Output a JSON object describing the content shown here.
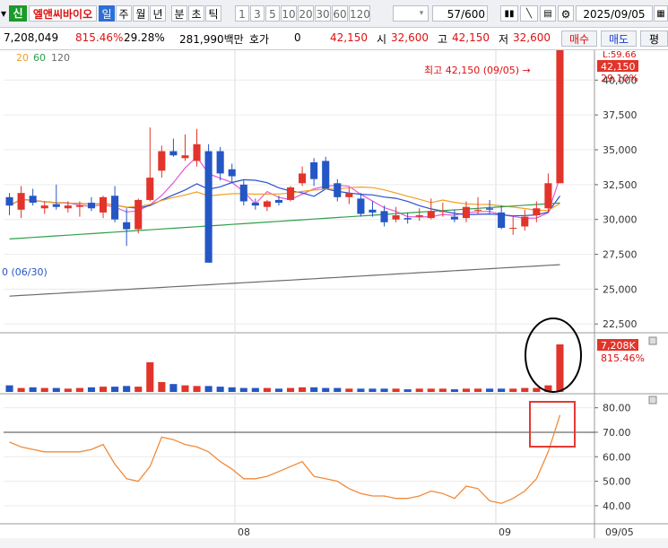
{
  "toolbar": {
    "market_badge": "신",
    "stock_name": "엘앤씨바이오",
    "periods": [
      "일",
      "주",
      "월",
      "년",
      "분",
      "초",
      "틱"
    ],
    "intervals": [
      "1",
      "3",
      "5",
      "10",
      "20",
      "30",
      "60",
      "120"
    ],
    "count": "57",
    "count_total": "/600",
    "date": "2025/09/05"
  },
  "quote": {
    "volume": "7,208,049",
    "volume_ratio": "815.46%",
    "turnover": "29.28%",
    "amount": "281,990백만",
    "hoga_label": "호가",
    "hoga_value": "0",
    "price": "42,150",
    "open_label": "시",
    "open": "32,600",
    "high_label": "고",
    "high": "42,150",
    "low_label": "저",
    "low": "32,600",
    "buy_label": "매수",
    "sell_label": "매도",
    "eval_label": "평"
  },
  "price_panel": {
    "ma_labels": [
      "20",
      "60",
      "120"
    ],
    "high_annotation": "최고 42,150 (09/05) →",
    "low_annotation": "0 (06/30)",
    "current_price_tag": "42,150",
    "current_change": "29.10%",
    "top_right_text": "L:59.66",
    "y_labels": [
      "40,000",
      "37,500",
      "35,000",
      "32,500",
      "30,000",
      "27,500",
      "25,000",
      "22,500"
    ]
  },
  "volume_panel": {
    "tag": "7,208K",
    "change": "815.46%"
  },
  "osc_panel": {
    "y_labels": [
      "80.00",
      "70.00",
      "60.00",
      "50.00",
      "40.00"
    ]
  },
  "x_axis": {
    "labels": [
      "08",
      "09"
    ],
    "current_label": "09/05"
  },
  "colors": {
    "up": "#e2342a",
    "down": "#2456c5",
    "ma5": "#e35bd6",
    "ma10": "#2b4fd0",
    "ma20": "#f0a020",
    "ma60": "#2ea04a",
    "ma120": "#6b6b6b",
    "osc": "#f08a3a",
    "highlight_box": "#e53935"
  },
  "chart_data": [
    {
      "type": "candlestick",
      "title": "",
      "ylim": [
        22500,
        41500
      ],
      "candles": [
        {
          "o": 31600,
          "h": 31900,
          "l": 30300,
          "c": 31000
        },
        {
          "o": 30700,
          "h": 32400,
          "l": 30100,
          "c": 31900
        },
        {
          "o": 31700,
          "h": 32200,
          "l": 31000,
          "c": 31200
        },
        {
          "o": 30800,
          "h": 31300,
          "l": 30400,
          "c": 31000
        },
        {
          "o": 31100,
          "h": 32500,
          "l": 30700,
          "c": 30900
        },
        {
          "o": 30800,
          "h": 31300,
          "l": 30500,
          "c": 31000
        },
        {
          "o": 30900,
          "h": 31300,
          "l": 30200,
          "c": 31000
        },
        {
          "o": 31200,
          "h": 31600,
          "l": 30600,
          "c": 30800
        },
        {
          "o": 30500,
          "h": 31700,
          "l": 30100,
          "c": 31600
        },
        {
          "o": 31700,
          "h": 32400,
          "l": 29800,
          "c": 30000
        },
        {
          "o": 29800,
          "h": 30800,
          "l": 28100,
          "c": 29300
        },
        {
          "o": 29300,
          "h": 31500,
          "l": 29000,
          "c": 31400
        },
        {
          "o": 31400,
          "h": 36600,
          "l": 31300,
          "c": 33000
        },
        {
          "o": 33500,
          "h": 35300,
          "l": 33000,
          "c": 34900
        },
        {
          "o": 34900,
          "h": 35800,
          "l": 34500,
          "c": 34600
        },
        {
          "o": 34400,
          "h": 36100,
          "l": 34200,
          "c": 34600
        },
        {
          "o": 34200,
          "h": 36500,
          "l": 33800,
          "c": 35400
        },
        {
          "o": 34900,
          "h": 35400,
          "l": 26900,
          "c": 26900
        },
        {
          "o": 34900,
          "h": 35200,
          "l": 32800,
          "c": 33300
        },
        {
          "o": 33600,
          "h": 34000,
          "l": 32600,
          "c": 33100
        },
        {
          "o": 32500,
          "h": 32800,
          "l": 31000,
          "c": 31300
        },
        {
          "o": 31200,
          "h": 31500,
          "l": 30700,
          "c": 31000
        },
        {
          "o": 30900,
          "h": 31400,
          "l": 30600,
          "c": 31300
        },
        {
          "o": 31400,
          "h": 31700,
          "l": 31000,
          "c": 31200
        },
        {
          "o": 31400,
          "h": 32400,
          "l": 31300,
          "c": 32300
        },
        {
          "o": 32600,
          "h": 33800,
          "l": 32400,
          "c": 33300
        },
        {
          "o": 34100,
          "h": 34400,
          "l": 32400,
          "c": 32900
        },
        {
          "o": 34200,
          "h": 34500,
          "l": 32400,
          "c": 32200
        },
        {
          "o": 32600,
          "h": 32900,
          "l": 31300,
          "c": 31600
        },
        {
          "o": 31600,
          "h": 32300,
          "l": 31100,
          "c": 31900
        },
        {
          "o": 31500,
          "h": 31900,
          "l": 30200,
          "c": 30400
        },
        {
          "o": 30700,
          "h": 31300,
          "l": 30200,
          "c": 30500
        },
        {
          "o": 30600,
          "h": 31000,
          "l": 29500,
          "c": 29800
        },
        {
          "o": 30000,
          "h": 30900,
          "l": 29800,
          "c": 30300
        },
        {
          "o": 30100,
          "h": 30500,
          "l": 29700,
          "c": 30000
        },
        {
          "o": 30200,
          "h": 30800,
          "l": 29900,
          "c": 30300
        },
        {
          "o": 30100,
          "h": 31500,
          "l": 30000,
          "c": 30600
        },
        {
          "o": 30600,
          "h": 31200,
          "l": 30200,
          "c": 30600
        },
        {
          "o": 30200,
          "h": 30700,
          "l": 29800,
          "c": 30000
        },
        {
          "o": 30100,
          "h": 31300,
          "l": 29800,
          "c": 30900
        },
        {
          "o": 30700,
          "h": 31600,
          "l": 30400,
          "c": 30700
        },
        {
          "o": 30800,
          "h": 31400,
          "l": 30400,
          "c": 30700
        },
        {
          "o": 30500,
          "h": 31000,
          "l": 29300,
          "c": 29400
        },
        {
          "o": 29400,
          "h": 30200,
          "l": 28900,
          "c": 29400
        },
        {
          "o": 29500,
          "h": 30700,
          "l": 29200,
          "c": 30200
        },
        {
          "o": 30300,
          "h": 31300,
          "l": 29800,
          "c": 30800
        },
        {
          "o": 30800,
          "h": 33300,
          "l": 30500,
          "c": 32600
        },
        {
          "o": 32600,
          "h": 42150,
          "l": 32600,
          "c": 42150
        }
      ]
    },
    {
      "type": "bar",
      "title": "",
      "values": [
        1,
        0.6,
        0.7,
        0.6,
        0.6,
        0.5,
        0.6,
        0.7,
        0.8,
        0.8,
        0.9,
        0.8,
        4.5,
        1.5,
        1.2,
        1.0,
        0.9,
        0.9,
        0.8,
        0.7,
        0.6,
        0.6,
        0.6,
        0.5,
        0.6,
        0.7,
        0.7,
        0.6,
        0.6,
        0.5,
        0.5,
        0.5,
        0.5,
        0.5,
        0.4,
        0.5,
        0.5,
        0.5,
        0.4,
        0.5,
        0.5,
        0.5,
        0.5,
        0.5,
        0.6,
        0.6,
        1.0,
        7.2
      ]
    },
    {
      "type": "line",
      "title": "",
      "ylim": [
        33,
        85
      ],
      "values": [
        66,
        64,
        63,
        62,
        62,
        62,
        62,
        63,
        65,
        57,
        51,
        50,
        56,
        68,
        67,
        65,
        64,
        62,
        58,
        55,
        51,
        51,
        52,
        54,
        56,
        58,
        52,
        51,
        50,
        47,
        45,
        44,
        44,
        43,
        43,
        44,
        46,
        45,
        43,
        48,
        47,
        42,
        41,
        43,
        46,
        51,
        62,
        77
      ]
    }
  ]
}
